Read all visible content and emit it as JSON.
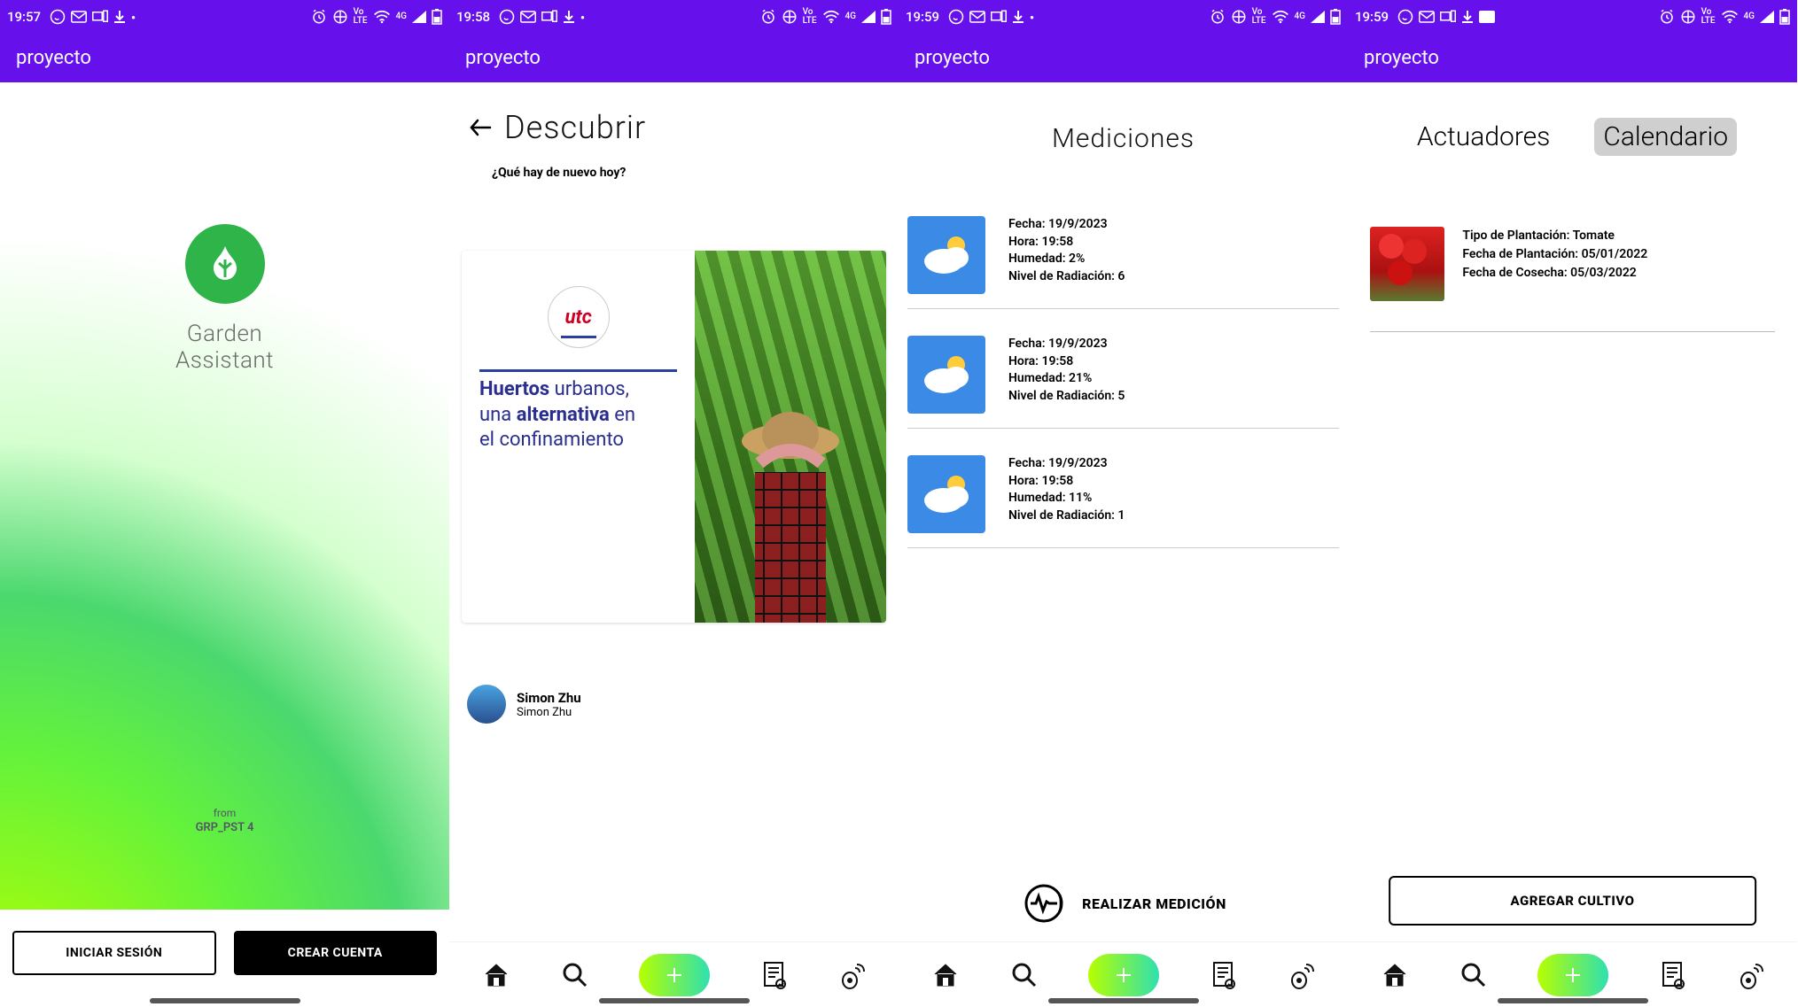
{
  "status": {
    "screens": [
      {
        "time": "19:57"
      },
      {
        "time": "19:58"
      },
      {
        "time": "19:59"
      },
      {
        "time": "19:59"
      }
    ],
    "net_label": "Vo\nLTE",
    "net_gen": "4G"
  },
  "appbar": {
    "title": "proyecto"
  },
  "screen1": {
    "app_name_line1": "Garden",
    "app_name_line2": "Assistant",
    "from_label": "from",
    "from_value": "GRP_PST 4",
    "login_label": "INICIAR SESIÓN",
    "create_label": "CREAR CUENTA"
  },
  "screen2": {
    "title": "Descubrir",
    "subtitle": "¿Qué hay de nuevo hoy?",
    "card_logo_text": "utc",
    "card_line1_html": "<b>Huertos</b> urbanos,",
    "card_line2_html": "una <b>alternativa</b> en",
    "card_line3": "el confinamiento",
    "author_name": "Simon Zhu",
    "author_sub": "Simon Zhu"
  },
  "screen3": {
    "title": "Mediciones",
    "items": [
      {
        "fecha": "Fecha: 19/9/2023",
        "hora": "Hora: 19:58",
        "humedad": "Humedad: 2%",
        "rad": "Nivel de Radiación: 6"
      },
      {
        "fecha": "Fecha: 19/9/2023",
        "hora": "Hora: 19:58",
        "humedad": "Humedad: 21%",
        "rad": "Nivel de Radiación: 5"
      },
      {
        "fecha": "Fecha: 19/9/2023",
        "hora": "Hora: 19:58",
        "humedad": "Humedad: 11%",
        "rad": "Nivel de Radiación: 1"
      }
    ],
    "action_label": "REALIZAR MEDICIÓN"
  },
  "screen4": {
    "tab1": "Actuadores",
    "tab2": "Calendario",
    "crop_type": "Tipo de Plantación: Tomate",
    "plant_date": "Fecha de Plantación: 05/01/2022",
    "harvest_date": "Fecha de Cosecha: 05/03/2022",
    "add_label": "AGREGAR CULTIVO"
  },
  "nav": {
    "home": "home-icon",
    "search": "search-icon",
    "add": "add-icon",
    "receipt": "receipt-icon",
    "sensor": "sensor-icon"
  }
}
